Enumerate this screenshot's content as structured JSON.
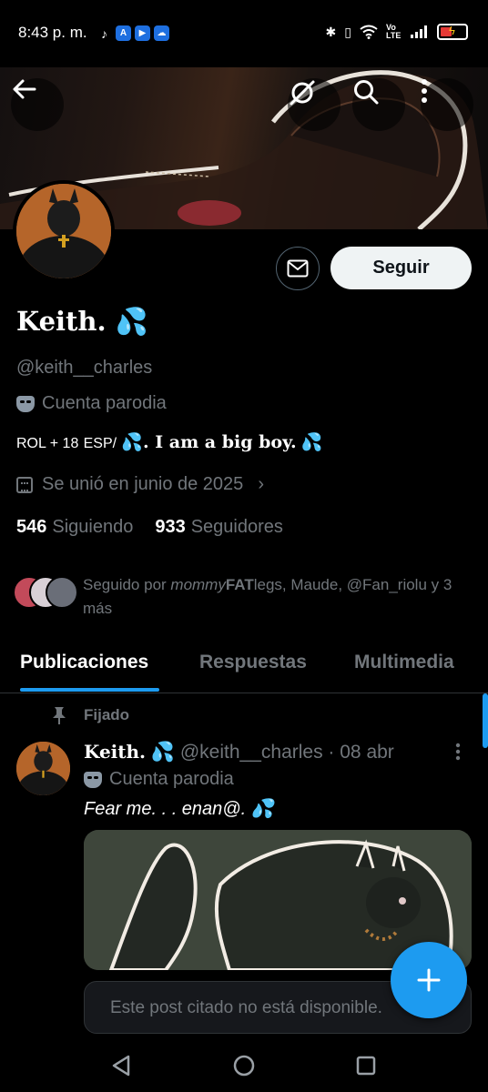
{
  "status_bar": {
    "time": "8:43 p. m.",
    "network_label": "Vo LTE"
  },
  "header": {
    "back_icon": "arrow-left-icon",
    "actions": [
      "mute-icon",
      "search-icon",
      "more-vertical-icon"
    ]
  },
  "profile": {
    "name": "Keith.",
    "name_emoji": "💦",
    "handle": "@keith__charles",
    "parody_label": "Cuenta parodia",
    "bio_prefix": "ROL + 18",
    "bio_lang": "ESP/",
    "bio_emoji_1": "💦",
    "bio_main": ". I am a big boy.",
    "bio_emoji_2": "💦",
    "joined": "Se unió en junio de 2025",
    "following_count": "546",
    "following_label": "Siguiendo",
    "followers_count": "933",
    "followers_label": "Seguidores",
    "follow_button": "Seguir",
    "followed_by_prefix": "Seguido por ",
    "followed_by_name1_a": "mommy",
    "followed_by_name1_b": "FAT",
    "followed_by_name1_c": "legs",
    "followed_by_rest": ", Maude, @Fan_riolu y 3 más"
  },
  "tabs": [
    "Publicaciones",
    "Respuestas",
    "Multimedia"
  ],
  "active_tab": "Publicaciones",
  "pinned_label": "Fijado",
  "post": {
    "author": "Keith.",
    "author_emoji": "💦",
    "handle_date": "@keith__charles · 08 abr",
    "parody_label": "Cuenta parodia",
    "text": "Fear me. . . enan@. 💦",
    "quote_text": "Este post citado no está disponible."
  },
  "colors": {
    "accent": "#1d9bf0",
    "background": "#000000",
    "muted": "#71767b",
    "follow_button_bg": "#eff3f4"
  }
}
